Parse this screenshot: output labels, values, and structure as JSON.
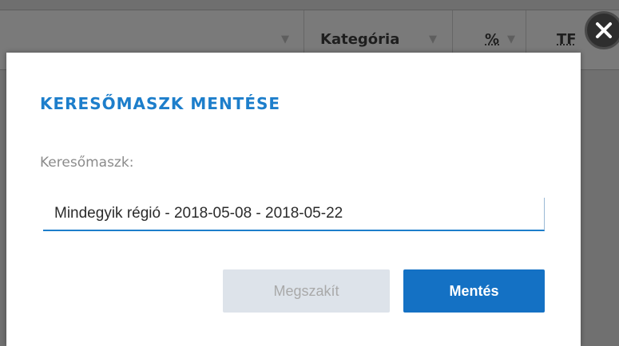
{
  "grid": {
    "columns": [
      {
        "label": ""
      },
      {
        "label": "Kategória"
      },
      {
        "label": "%"
      },
      {
        "label": "TF"
      }
    ],
    "filter_icon": "filter-icon"
  },
  "modal": {
    "title": "KERESŐMASZK MENTÉSE",
    "field_label": "Keresőmaszk:",
    "input_value": "Mindegyik régió - 2018-05-08 - 2018-05-22",
    "cancel_label": "Megszakít",
    "save_label": "Mentés",
    "close_icon": "close-icon"
  },
  "colors": {
    "accent": "#1d7ecb",
    "primary_button": "#1471c4",
    "disabled_button": "#dde3ea"
  }
}
